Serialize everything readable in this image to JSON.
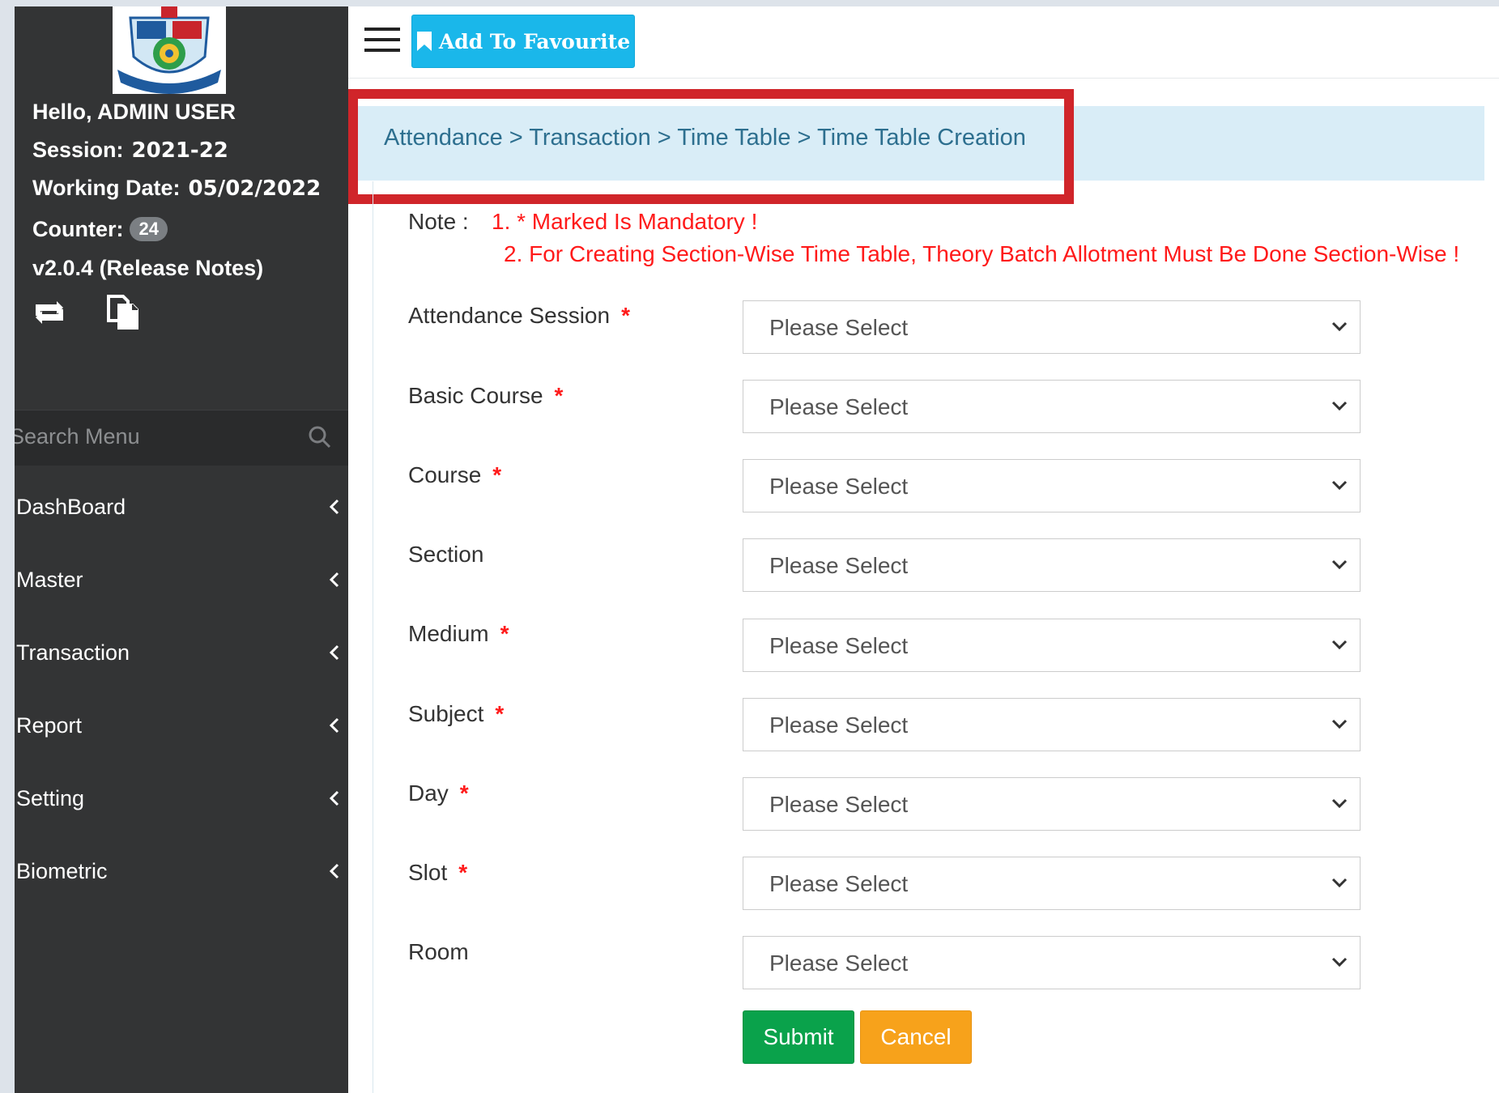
{
  "sidebar": {
    "user": {
      "greeting": "Hello, ADMIN USER"
    },
    "session": {
      "label": "Session:",
      "value": "2021-22"
    },
    "working_date": {
      "label": "Working Date:",
      "value": "05/02/2022"
    },
    "counter": {
      "label": "Counter:",
      "value": "24"
    },
    "version": "v2.0.4 (Release Notes)",
    "search": {
      "placeholder": "Search Menu"
    },
    "menu": [
      {
        "label": "DashBoard"
      },
      {
        "label": "Master"
      },
      {
        "label": "Transaction"
      },
      {
        "label": "Report"
      },
      {
        "label": "Setting"
      },
      {
        "label": "Biometric"
      }
    ]
  },
  "topbar": {
    "favourite_label": "Add To Favourite"
  },
  "breadcrumb": "Attendance > Transaction > Time Table > Time Table Creation",
  "note": {
    "label": "Note :",
    "line1": "1. * Marked Is Mandatory !",
    "line2": "2. For Creating Section-Wise Time Table, Theory Batch Allotment Must Be Done Section-Wise !"
  },
  "form": {
    "required_mark": "*",
    "fields": [
      {
        "label": "Attendance Session",
        "value": "Please Select"
      },
      {
        "label": "Basic Course",
        "value": "Please Select"
      },
      {
        "label": "Course",
        "value": "Please Select"
      },
      {
        "label": "Section",
        "value": "Please Select"
      },
      {
        "label": "Medium",
        "value": "Please Select"
      },
      {
        "label": "Subject",
        "value": "Please Select"
      },
      {
        "label": "Day",
        "value": "Please Select"
      },
      {
        "label": "Slot",
        "value": "Please Select"
      },
      {
        "label": "Room",
        "value": "Please Select"
      }
    ],
    "submit_label": "Submit",
    "cancel_label": "Cancel"
  },
  "colors": {
    "sidebar_bg": "#333435",
    "favourite_btn": "#1ab7ea",
    "breadcrumb_bg": "#d9edf7",
    "highlight_border": "#d0252a",
    "note_text": "#ff1a1a",
    "submit_btn": "#0aa24b",
    "cancel_btn": "#f7a21b"
  }
}
